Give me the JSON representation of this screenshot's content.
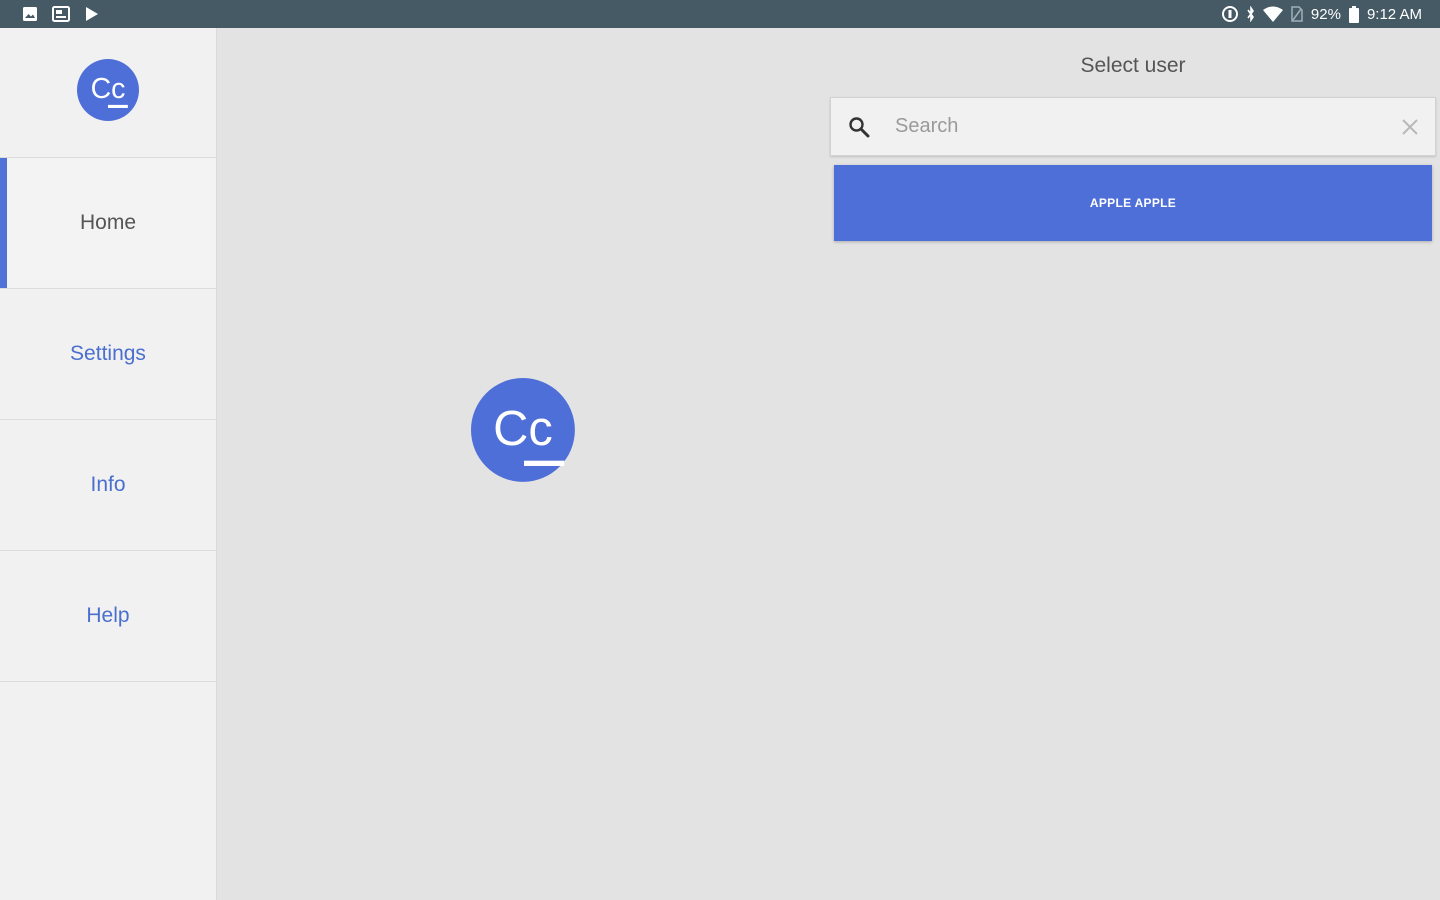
{
  "status_bar": {
    "left_icons": [
      "image-icon",
      "gallery-icon",
      "play-store-icon"
    ],
    "right_icons": [
      "sync-icon",
      "bluetooth-icon",
      "wifi-icon",
      "no-sim-icon",
      "battery-icon"
    ],
    "battery": "92%",
    "time": "9:12 AM"
  },
  "sidebar": {
    "logo_icon": "cc-logo-icon",
    "items": [
      {
        "label": "Home",
        "active": true
      },
      {
        "label": "Settings",
        "active": false
      },
      {
        "label": "Info",
        "active": false
      },
      {
        "label": "Help",
        "active": false
      }
    ]
  },
  "main": {
    "center_logo_icon": "cc-logo-icon"
  },
  "user_panel": {
    "title": "Select user",
    "search": {
      "placeholder": "Search",
      "value": ""
    },
    "users": [
      {
        "label": "APPLE APPLE"
      }
    ]
  },
  "colors": {
    "accent": "#4f6fd8",
    "status_bar": "#455a64",
    "background": "#e3e3e3",
    "sidebar": "#f1f1f1",
    "link_text": "#4a6fcf"
  }
}
